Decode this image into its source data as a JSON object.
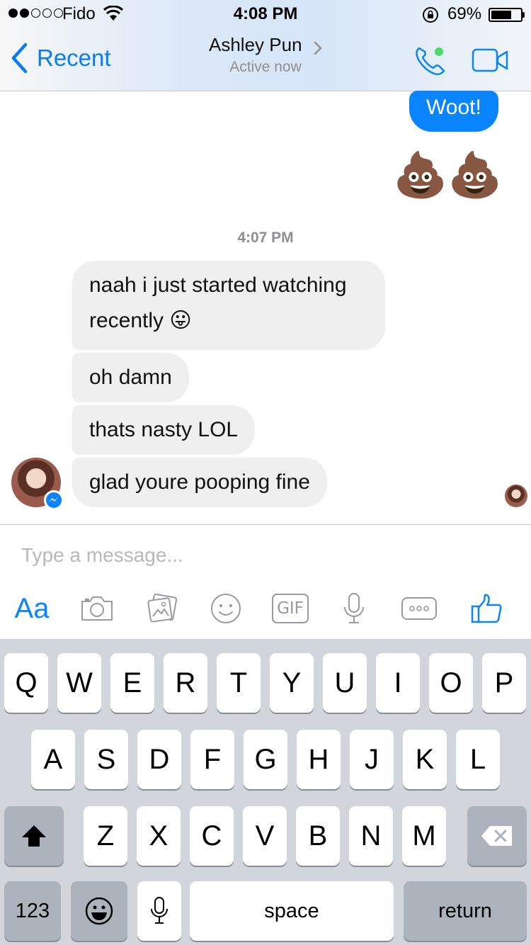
{
  "status_bar": {
    "carrier": "Fido",
    "time": "4:08 PM",
    "battery_percent": "69%",
    "battery_level": 0.69,
    "signal_bars_filled": 2,
    "signal_bars_total": 5
  },
  "header": {
    "back_label": "Recent",
    "contact_name": "Ashley Pun",
    "active_status": "Active now"
  },
  "messages": {
    "sent_text": "Woot!",
    "sent_emoji": "💩💩",
    "timestamp": "4:07 PM",
    "received": [
      "naah i just started watching recently 😛",
      "oh damn",
      "thats nasty LOL",
      "glad youre pooping fine"
    ]
  },
  "composer": {
    "placeholder": "Type a message...",
    "text_tool_label": "Aa",
    "gif_label": "GIF"
  },
  "keyboard": {
    "row1": [
      "Q",
      "W",
      "E",
      "R",
      "T",
      "Y",
      "U",
      "I",
      "O",
      "P"
    ],
    "row2": [
      "A",
      "S",
      "D",
      "F",
      "G",
      "H",
      "J",
      "K",
      "L"
    ],
    "row3": [
      "Z",
      "X",
      "C",
      "V",
      "B",
      "N",
      "M"
    ],
    "numbers_label": "123",
    "space_label": "space",
    "return_label": "return"
  },
  "colors": {
    "accent": "#0a84ff",
    "bubble_incoming": "#efefef",
    "online_dot": "#4cd964"
  }
}
